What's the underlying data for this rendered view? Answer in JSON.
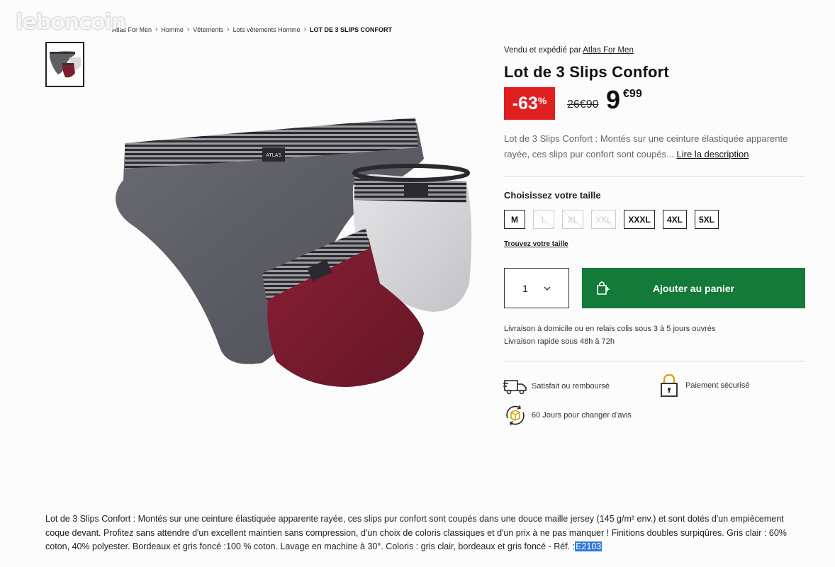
{
  "watermark": "leboncoin",
  "breadcrumb": {
    "items": [
      "Atlas For Men",
      "Homme",
      "Vêtements",
      "Lots vêtements Homme"
    ],
    "current": "LOT DE 3 SLIPS CONFORT"
  },
  "seller": {
    "prefix": "Vendu et expédié par",
    "name": "Atlas For Men"
  },
  "product": {
    "title": "Lot de 3 Slips Confort",
    "discount": "-63",
    "discount_unit": "%",
    "old_price": "26€90",
    "price_int": "9",
    "price_dec": "€99",
    "short_description": "Lot de 3 Slips Confort : Montés sur une ceinture élastiquée apparente rayée, ces slips pur confort sont coupés...",
    "read_more": "Lire la description",
    "brand_mark": "ATLAS"
  },
  "size_selector": {
    "label": "Choisissez votre taille",
    "options": [
      {
        "label": "M",
        "available": true
      },
      {
        "label": "L",
        "available": false
      },
      {
        "label": "XL",
        "available": false
      },
      {
        "label": "XXL",
        "available": false
      },
      {
        "label": "XXXL",
        "available": true
      },
      {
        "label": "4XL",
        "available": true
      },
      {
        "label": "5XL",
        "available": true
      }
    ],
    "guide_link": "Trouvez votre taille"
  },
  "cart": {
    "quantity": "1",
    "add_button": "Ajouter au panier"
  },
  "delivery": {
    "line1": "Livraison à domicile ou en relais colis sous 3 à 5 jours ouvrés",
    "line2": "Livraison rapide sous 48h à 72h"
  },
  "features": {
    "refund": "Satisfait ou remboursé",
    "secure": "Paiement sécurisé",
    "returns": "60 Jours pour changer d'avis"
  },
  "long_description": {
    "text": "Lot de 3 Slips Confort : Montés sur une ceinture élastiquée apparente rayée, ces slips pur confort sont coupés dans une douce maille jersey (145 g/m² env.) et sont dotés d'un empiècement coque devant. Profitez sans attendre d'un excellent maintien sans compression, d'un choix de coloris classiques et d'un prix à ne pas manquer ! Finitions doubles surpiqûres. Gris clair : 60% coton, 40% polyester. Bordeaux et gris foncé :100 % coton. Lavage en machine à 30°. Coloris : gris clair, bordeaux et gris foncé - Réf. :",
    "ref": "E2103"
  },
  "colors": {
    "discount_red": "#e02020",
    "button_green": "#137a3a",
    "dark_grey": "#5f5f66",
    "light_grey": "#d8d8d8",
    "bordeaux": "#7c1d30",
    "selection_blue": "#2f7ad8"
  }
}
